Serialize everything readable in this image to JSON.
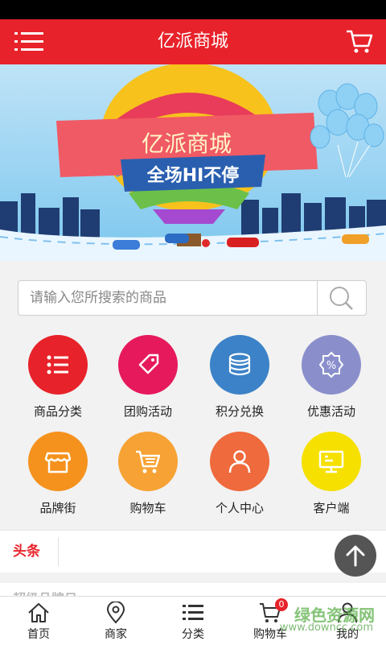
{
  "header": {
    "title": "亿派商城"
  },
  "banner": {
    "line1": "亿派商城",
    "line2": "全场HI不停"
  },
  "search": {
    "placeholder": "请输入您所搜索的商品"
  },
  "grid": [
    {
      "label": "商品分类",
      "color": "#e8222a",
      "icon": "list-icon"
    },
    {
      "label": "团购活动",
      "color": "#e6195c",
      "icon": "tag-icon"
    },
    {
      "label": "积分兑换",
      "color": "#3b82c8",
      "icon": "coins-icon"
    },
    {
      "label": "优惠活动",
      "color": "#8a8fcc",
      "icon": "discount-icon"
    },
    {
      "label": "品牌街",
      "color": "#f5921e",
      "icon": "storefront-icon"
    },
    {
      "label": "购物车",
      "color": "#f7a234",
      "icon": "shopping-cart-icon"
    },
    {
      "label": "个人中心",
      "color": "#ef6a3c",
      "icon": "user-icon"
    },
    {
      "label": "客户端",
      "color": "#f6e000",
      "icon": "monitor-icon"
    }
  ],
  "news": {
    "tag": "头条"
  },
  "strip": {
    "text": "超级品牌日"
  },
  "tabs": [
    {
      "label": "首页",
      "icon": "home-icon"
    },
    {
      "label": "商家",
      "icon": "location-pin-icon"
    },
    {
      "label": "分类",
      "icon": "list-icon"
    },
    {
      "label": "购物车",
      "icon": "cart-icon",
      "badge": "0"
    },
    {
      "label": "我的",
      "icon": "user-icon"
    }
  ],
  "watermark": {
    "line1": "绿色资源网",
    "line2": "www.downcc.com"
  }
}
